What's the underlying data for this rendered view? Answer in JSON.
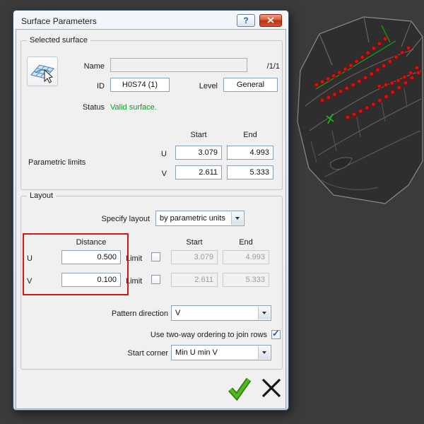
{
  "window": {
    "title": "Surface Parameters",
    "help_glyph": "?"
  },
  "selected_surface": {
    "group_label": "Selected surface",
    "name_label": "Name",
    "name_value": "",
    "name_suffix": "/1/1",
    "id_label": "ID",
    "id_value": "H0S74 (1)",
    "level_label": "Level",
    "level_value": "General",
    "status_label": "Status",
    "status_value": "Valid surface.",
    "start_header": "Start",
    "end_header": "End",
    "limits_label": "Parametric limits",
    "u_label": "U",
    "v_label": "V",
    "u_start": "3.079",
    "u_end": "4.993",
    "v_start": "2.611",
    "v_end": "5.333"
  },
  "layout_group": {
    "group_label": "Layout",
    "specify_label": "Specify layout",
    "specify_value": "by parametric units",
    "distance_header": "Distance",
    "start_header": "Start",
    "end_header": "End",
    "u_label": "U",
    "u_distance": "0.500",
    "u_limit_label": "Limit",
    "u_limit_checked": false,
    "u_start": "3.079",
    "u_end": "4.993",
    "v_label": "V",
    "v_distance": "0.100",
    "v_limit_label": "Limit",
    "v_limit_checked": false,
    "v_start": "2.611",
    "v_end": "5.333",
    "pattern_label": "Pattern direction",
    "pattern_value": "V",
    "two_way_label": "Use two-way ordering to join rows",
    "two_way_checked": true,
    "corner_label": "Start corner",
    "corner_value": "Min U min V"
  },
  "colors": {
    "status_green": "#00a01e",
    "highlight_red": "#d01818",
    "ok_green": "#52b81e",
    "point_red": "#cf1212"
  }
}
